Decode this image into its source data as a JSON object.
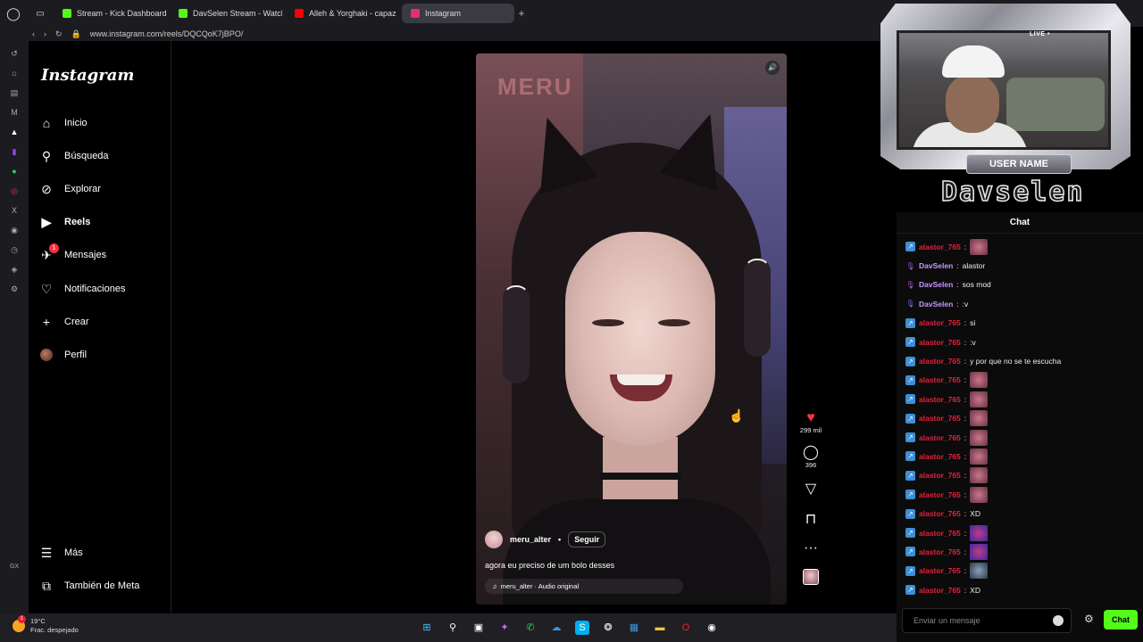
{
  "browser": {
    "tabs": [
      {
        "label": "Stream - Kick Dashboard",
        "color": "#53fc18"
      },
      {
        "label": "DavSelen Stream - Watch",
        "color": "#53fc18"
      },
      {
        "label": "Alleh & Yorghaki - capaz",
        "color": "#ff0000"
      },
      {
        "label": "Instagram",
        "color": "#e1306c",
        "active": true
      }
    ],
    "url": "www.instagram.com/reels/DQCQoK7jBPO/"
  },
  "instagram": {
    "logo": "Instagram",
    "nav": [
      {
        "label": "Inicio",
        "icon": "home-icon"
      },
      {
        "label": "Búsqueda",
        "icon": "search-icon"
      },
      {
        "label": "Explorar",
        "icon": "compass-icon"
      },
      {
        "label": "Reels",
        "icon": "reels-icon"
      },
      {
        "label": "Mensajes",
        "icon": "messenger-icon",
        "badge": "1"
      },
      {
        "label": "Notificaciones",
        "icon": "heart-icon"
      },
      {
        "label": "Crear",
        "icon": "plus-icon"
      },
      {
        "label": "Perfil",
        "icon": "avatar"
      }
    ],
    "more": "Más",
    "meta": "También de Meta",
    "reel": {
      "username": "meru_alter",
      "follow": "Seguir",
      "caption": "agora eu preciso de um bolo desses",
      "audio": "meru_alter · Audio original",
      "sign_text": "MERU",
      "likes": "299 mil",
      "comments": "396"
    }
  },
  "overlay": {
    "live": "LIVE •",
    "username_label": "USER NAME",
    "streamer": "Davselen"
  },
  "chat": {
    "title": "Chat",
    "messages": [
      {
        "user": "alastor_765",
        "text": "",
        "emote": "emote",
        "role": "sub",
        "color": "#e4213a"
      },
      {
        "user": "DavSelen",
        "text": "alastor",
        "role": "broadcaster",
        "color": "#c896ff"
      },
      {
        "user": "DavSelen",
        "text": "sos mod",
        "role": "broadcaster",
        "color": "#c896ff"
      },
      {
        "user": "DavSelen",
        "text": ":v",
        "role": "broadcaster",
        "color": "#c896ff"
      },
      {
        "user": "alastor_765",
        "text": "si",
        "role": "sub",
        "color": "#e4213a"
      },
      {
        "user": "alastor_765",
        "text": ":v",
        "role": "sub",
        "color": "#e4213a"
      },
      {
        "user": "alastor_765",
        "text": "y por que no se te escucha",
        "role": "sub",
        "color": "#e4213a"
      },
      {
        "user": "alastor_765",
        "text": "",
        "emote": "emote",
        "role": "sub",
        "color": "#e4213a"
      },
      {
        "user": "alastor_765",
        "text": "",
        "emote": "emote",
        "role": "sub",
        "color": "#e4213a"
      },
      {
        "user": "alastor_765",
        "text": "",
        "emote": "emote",
        "role": "sub",
        "color": "#e4213a"
      },
      {
        "user": "alastor_765",
        "text": "",
        "emote": "emote",
        "role": "sub",
        "color": "#e4213a"
      },
      {
        "user": "alastor_765",
        "text": "",
        "emote": "emote",
        "role": "sub",
        "color": "#e4213a"
      },
      {
        "user": "alastor_765",
        "text": "",
        "emote": "emote",
        "role": "sub",
        "color": "#e4213a"
      },
      {
        "user": "alastor_765",
        "text": "",
        "emote": "emote",
        "role": "sub",
        "color": "#e4213a"
      },
      {
        "user": "alastor_765",
        "text": "XD",
        "role": "sub",
        "color": "#e4213a"
      },
      {
        "user": "alastor_765",
        "text": "",
        "emote": "emote2",
        "role": "sub",
        "color": "#e4213a"
      },
      {
        "user": "alastor_765",
        "text": "",
        "emote": "emote2",
        "role": "sub",
        "color": "#e4213a"
      },
      {
        "user": "alastor_765",
        "text": "",
        "emote": "emote3",
        "role": "sub",
        "color": "#e4213a"
      },
      {
        "user": "alastor_765",
        "text": "XD",
        "role": "sub",
        "color": "#e4213a"
      }
    ],
    "input_placeholder": "Enviar un mensaje",
    "send": "Chat",
    "accent": "#53fc18"
  },
  "taskbar": {
    "temperature": "19°C",
    "weather": "Frac. despejado",
    "weather_badge": "1"
  }
}
